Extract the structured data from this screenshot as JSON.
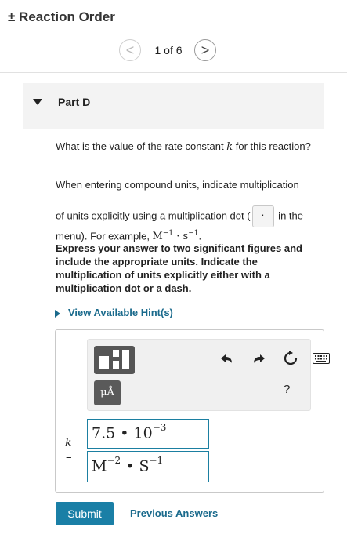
{
  "header": {
    "title": "± Reaction Order"
  },
  "pager": {
    "prev_symbol": "<",
    "count": "1 of 6",
    "next_symbol": ">"
  },
  "part": {
    "label": "Part D"
  },
  "question": {
    "q1_before": "What is the value of the rate constant ",
    "q1_var": "k",
    "q1_after": " for this reaction?",
    "q2": "When entering compound units, indicate multiplication",
    "q3_before": "of units explicitly using a multiplication dot (",
    "q3_dot": "·",
    "q3_mid": " in the menu). For example, ",
    "q3_ex_m": "M",
    "q3_ex_m_exp": "−1",
    "q3_ex_dot": " · ",
    "q3_ex_s": "s",
    "q3_ex_s_exp": "−1",
    "q3_end": ".",
    "instructions": "Express your answer to two significant figures and include the appropriate units. Indicate the multiplication of units explicitly either with a multiplication dot or a dash."
  },
  "hint": {
    "label": "View Available Hint(s)"
  },
  "toolbar": {
    "template_icon": "template-icon",
    "units_label": "μÅ",
    "undo_icon": "undo-icon",
    "redo_icon": "redo-icon",
    "reset_icon": "reset-icon",
    "keyboard_icon": "keyboard-icon",
    "help_label": "?"
  },
  "answer": {
    "var_label": "k",
    "eq_label": "=",
    "value_mantissa": "7.5 • 10",
    "value_exponent": "−3",
    "unit_m": "M",
    "unit_m_exp": "−2",
    "unit_dot": " • ",
    "unit_s": "S",
    "unit_s_exp": "−1"
  },
  "actions": {
    "submit_label": "Submit",
    "previous_answers_label": "Previous Answers"
  }
}
